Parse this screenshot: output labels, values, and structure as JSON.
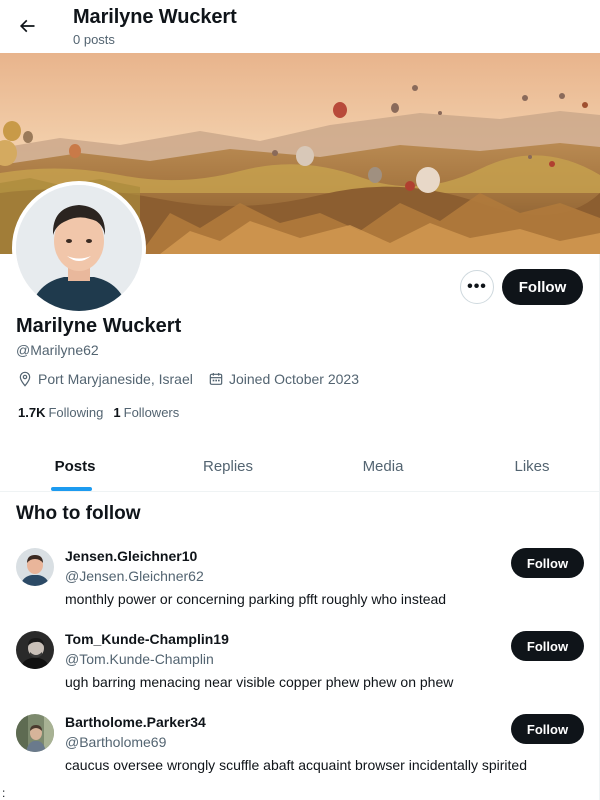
{
  "header": {
    "name": "Marilyne Wuckert",
    "posts_count": "0 posts"
  },
  "profile": {
    "name": "Marilyne Wuckert",
    "handle": "@Marilyne62",
    "location": "Port Maryjaneside, Israel",
    "joined": "Joined October 2023",
    "following_count": "1.7K",
    "following_label": "Following",
    "followers_count": "1",
    "followers_label": "Followers",
    "more_label": "•••",
    "follow_label": "Follow"
  },
  "tabs": [
    {
      "label": "Posts",
      "active": true
    },
    {
      "label": "Replies",
      "active": false
    },
    {
      "label": "Media",
      "active": false
    },
    {
      "label": "Likes",
      "active": false
    }
  ],
  "who_to_follow": {
    "title": "Who to follow",
    "users": [
      {
        "name": "Jensen.Gleichner10",
        "handle": "@Jensen.Gleichner62",
        "bio": "monthly power or concerning parking pfft roughly who instead",
        "follow_label": "Follow"
      },
      {
        "name": "Tom_Kunde-Champlin19",
        "handle": "@Tom.Kunde-Champlin",
        "bio": "ugh barring menacing near visible copper phew phew on phew",
        "follow_label": "Follow"
      },
      {
        "name": "Bartholome.Parker34",
        "handle": "@Bartholome69",
        "bio": "caucus oversee wrongly scuffle abaft acquaint browser incidentally spirited",
        "follow_label": "Follow"
      }
    ]
  },
  "stray_text": ":",
  "colors": {
    "text_primary": "#0f1419",
    "text_secondary": "#536471",
    "accent": "#1d9bf0",
    "button_dark": "#0f1419"
  }
}
